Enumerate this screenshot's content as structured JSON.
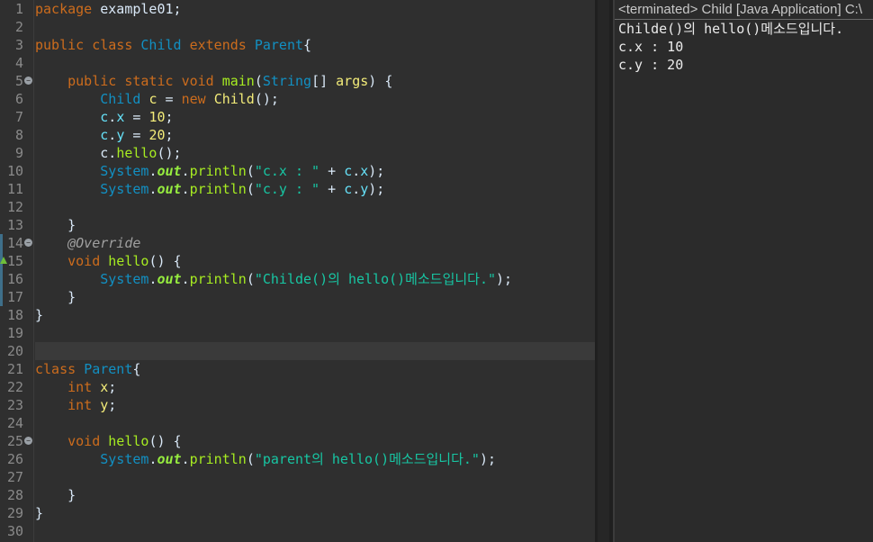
{
  "editor": {
    "line_numbers": [
      "1",
      "2",
      "3",
      "4",
      "5",
      "6",
      "7",
      "8",
      "9",
      "10",
      "11",
      "12",
      "13",
      "14",
      "15",
      "16",
      "17",
      "18",
      "19",
      "20",
      "21",
      "22",
      "23",
      "24",
      "25",
      "26",
      "27",
      "28",
      "29",
      "30"
    ],
    "tokens": {
      "l1_a": "package",
      "l1_b": " example01;",
      "l3_a": "public",
      "l3_b": " ",
      "l3_c": "class",
      "l3_d": " ",
      "l3_e": "Child",
      "l3_f": " ",
      "l3_g": "extends",
      "l3_h": " ",
      "l3_i": "Parent",
      "l3_j": "{",
      "l5_ind": "    ",
      "l5_a": "public",
      "l5_b": " ",
      "l5_c": "static",
      "l5_d": " ",
      "l5_e": "void",
      "l5_f": " ",
      "l5_g": "main",
      "l5_h": "(",
      "l5_i": "String",
      "l5_j": "[] ",
      "l5_k": "args",
      "l5_l": ") {",
      "l6_ind": "        ",
      "l6_a": "Child",
      "l6_b": " ",
      "l6_c": "c",
      "l6_d": " = ",
      "l6_e": "new",
      "l6_f": " ",
      "l6_g": "Child",
      "l6_h": "();",
      "l7_ind": "        ",
      "l7_a": "c",
      "l7_b": ".",
      "l7_c": "x",
      "l7_d": " = ",
      "l7_e": "10",
      "l7_f": ";",
      "l8_ind": "        ",
      "l8_a": "c",
      "l8_b": ".",
      "l8_c": "y",
      "l8_d": " = ",
      "l8_e": "20",
      "l8_f": ";",
      "l9_ind": "        ",
      "l9_a": "c",
      "l9_b": ".",
      "l9_c": "hello",
      "l9_d": "();",
      "l10_ind": "        ",
      "l10_a": "System",
      "l10_b": ".",
      "l10_c": "out",
      "l10_d": ".",
      "l10_e": "println",
      "l10_f": "(",
      "l10_g": "\"c.x : \"",
      "l10_h": " + ",
      "l10_i": "c",
      "l10_j": ".",
      "l10_k": "x",
      "l10_l": ");",
      "l11_ind": "        ",
      "l11_a": "System",
      "l11_b": ".",
      "l11_c": "out",
      "l11_d": ".",
      "l11_e": "println",
      "l11_f": "(",
      "l11_g": "\"c.y : \"",
      "l11_h": " + ",
      "l11_i": "c",
      "l11_j": ".",
      "l11_k": "y",
      "l11_l": ");",
      "l13_a": "    }",
      "l14_ind": "    ",
      "l14_a": "@Override",
      "l15_ind": "    ",
      "l15_a": "void",
      "l15_b": " ",
      "l15_c": "hello",
      "l15_d": "() {",
      "l16_ind": "        ",
      "l16_a": "System",
      "l16_b": ".",
      "l16_c": "out",
      "l16_d": ".",
      "l16_e": "println",
      "l16_f": "(",
      "l16_g": "\"Childe()의 hello()메소드입니다.\"",
      "l16_h": ");",
      "l17_a": "    }",
      "l18_a": "}",
      "l21_a": "class",
      "l21_b": " ",
      "l21_c": "Parent",
      "l21_d": "{",
      "l22_ind": "    ",
      "l22_a": "int",
      "l22_b": " ",
      "l22_c": "x",
      "l22_d": ";",
      "l23_ind": "    ",
      "l23_a": "int",
      "l23_b": " ",
      "l23_c": "y",
      "l23_d": ";",
      "l25_ind": "    ",
      "l25_a": "void",
      "l25_b": " ",
      "l25_c": "hello",
      "l25_d": "() {",
      "l26_ind": "        ",
      "l26_a": "System",
      "l26_b": ".",
      "l26_c": "out",
      "l26_d": ".",
      "l26_e": "println",
      "l26_f": "(",
      "l26_g": "\"parent의 hello()메소드입니다.\"",
      "l26_h": ");",
      "l28_a": "    }",
      "l29_a": "}"
    },
    "fold_glyph": "−",
    "colors": {
      "keyword": "#cc6c1d",
      "type": "#1290c3",
      "method": "#a7ec21",
      "local_var": "#f3ec79",
      "field": "#66e1f8",
      "string": "#17c6a3"
    }
  },
  "console": {
    "title": "<terminated> Child [Java Application] C:\\",
    "lines": [
      "Childe()의 hello()메소드입니다.",
      "c.x : 10",
      "c.y : 20"
    ]
  }
}
